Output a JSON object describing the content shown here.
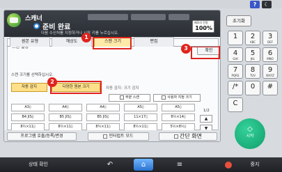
{
  "topbar": {
    "help": "?",
    "sleep": "☾"
  },
  "app": {
    "title": "스캐너",
    "status": "준비 완료",
    "status_sub": "다음 수신처를 지정하거나 시작 키를 누르십시오.",
    "memory_label": "메모리 잔량",
    "memory_value": "100%"
  },
  "settings": {
    "title": "스캔 설정",
    "confirm": "확인",
    "tabs": [
      "원본 유형",
      "해상도",
      "스캔 크기",
      "편집"
    ],
    "active_tab": "스캔 크기",
    "size_label": "스캔 크기를 선택하십시오.",
    "auto_detect": "자동 감지",
    "mixed_sizes": "다양한 원본 크기",
    "auto_detect_note": "자동 감지: 크기 감지",
    "partial_scan": "부분 스캔",
    "custom_size": "사용자 지정 크기",
    "sizes": [
      [
        "A3▯",
        "A4▯",
        "A4▯",
        "A5▯",
        "A5▯"
      ],
      [
        "B4 JIS▯",
        "B5 JIS▯",
        "B5 JIS▯",
        "11×17▯",
        "8½×14▯"
      ],
      [
        "8½×11▯",
        "8½×11▯",
        "8½×11▯",
        "8½×11▯",
        "5½×8½▯"
      ]
    ],
    "page": "1/2",
    "up": "▲",
    "down": "▼"
  },
  "badges": [
    "1",
    "2",
    "3"
  ],
  "bottom": {
    "program": "프로그램 호출/등록/변경",
    "interrupt": "인터럽트 모드",
    "simple": "간단 화면"
  },
  "keypad": {
    "reset": "초기화",
    "keys": [
      {
        "main": "1",
        "sub": ""
      },
      {
        "main": "2",
        "sub": "ABC"
      },
      {
        "main": "3",
        "sub": "DEF"
      },
      {
        "main": "4",
        "sub": "GHI"
      },
      {
        "main": "5",
        "sub": "JKL"
      },
      {
        "main": "6",
        "sub": "MNO"
      },
      {
        "main": "7",
        "sub": "PQRS"
      },
      {
        "main": "8",
        "sub": "TUV"
      },
      {
        "main": "9",
        "sub": "WXYZ"
      },
      {
        "main": "/*",
        "sub": ""
      },
      {
        "main": "0",
        "sub": ""
      },
      {
        "main": "#",
        "sub": ""
      },
      {
        "main": "C",
        "sub": ""
      }
    ],
    "start": "시작",
    "start_icon": "◇"
  },
  "footer": {
    "status_check": "상태 확인",
    "back_icon": "↶",
    "home_icon": "⌂",
    "menu_icon": "≡",
    "stop": "중지"
  },
  "colors": {
    "highlight": "#e0231d",
    "accent_tab": "#ffe9a8",
    "start": "#20b87e",
    "home": "#3b86e0"
  }
}
